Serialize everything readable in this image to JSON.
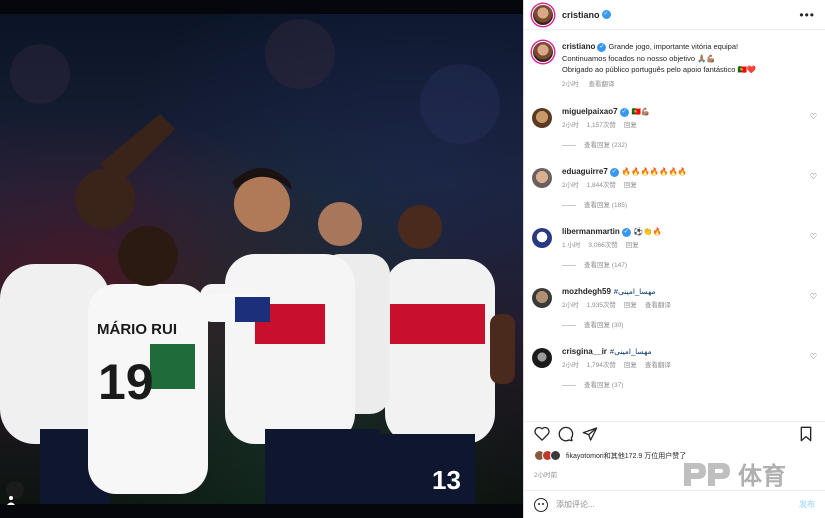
{
  "post": {
    "author": "cristiano",
    "caption_line1": "Grande jogo, importante vitória equipa!",
    "caption_line2": "Continuamos focados no nosso objetivo 🙏🏽💪🏽",
    "caption_line3": "Obrigado ao público português pelo apoio fantástico 🇵🇹❤️",
    "caption_time": "2小时",
    "caption_translate": "查看翻译"
  },
  "photo": {
    "jersey_name": "MÁRIO RUI",
    "jersey_number": "19",
    "jersey_number_right": "13"
  },
  "comments": [
    {
      "user": "miguelpaixao7",
      "verified": true,
      "text": "🇵🇹💪🏽",
      "time": "2小时",
      "likes": "1,157次赞",
      "reply": "回复",
      "translate": "",
      "view_replies": "查看回复 (232)"
    },
    {
      "user": "eduaguirre7",
      "verified": true,
      "text": "🔥🔥🔥🔥🔥🔥🔥",
      "time": "2小时",
      "likes": "1,844次赞",
      "reply": "回复",
      "translate": "",
      "view_replies": "查看回复 (185)"
    },
    {
      "user": "libermanmartin",
      "verified": true,
      "text": "⚽👏🔥",
      "time": "1 小时",
      "likes": "3,066次赞",
      "reply": "回复",
      "translate": "",
      "view_replies": "查看回复 (147)"
    },
    {
      "user": "mozhdegh59",
      "verified": false,
      "text": "#مهسا_امینی",
      "time": "2小时",
      "likes": "1,935次赞",
      "reply": "回复",
      "translate": "查看翻译",
      "view_replies": "查看回复 (30)"
    },
    {
      "user": "crisgina__ir",
      "verified": false,
      "text": "#مهسا_امینی",
      "time": "2小时",
      "likes": "1,794次赞",
      "reply": "回复",
      "translate": "查看翻译",
      "view_replies": "查看回复 (37)"
    }
  ],
  "likes_summary": "fikayotomori和其他172.9 万位用户赞了",
  "post_time": "2小时前",
  "add_comment": {
    "placeholder": "添加评论...",
    "post_label": "发布"
  },
  "watermark": {
    "text": "体育"
  },
  "colors": {
    "verified": "#3897f0",
    "portugal_red": "#c8102e",
    "link_blue": "#b2dffc"
  }
}
